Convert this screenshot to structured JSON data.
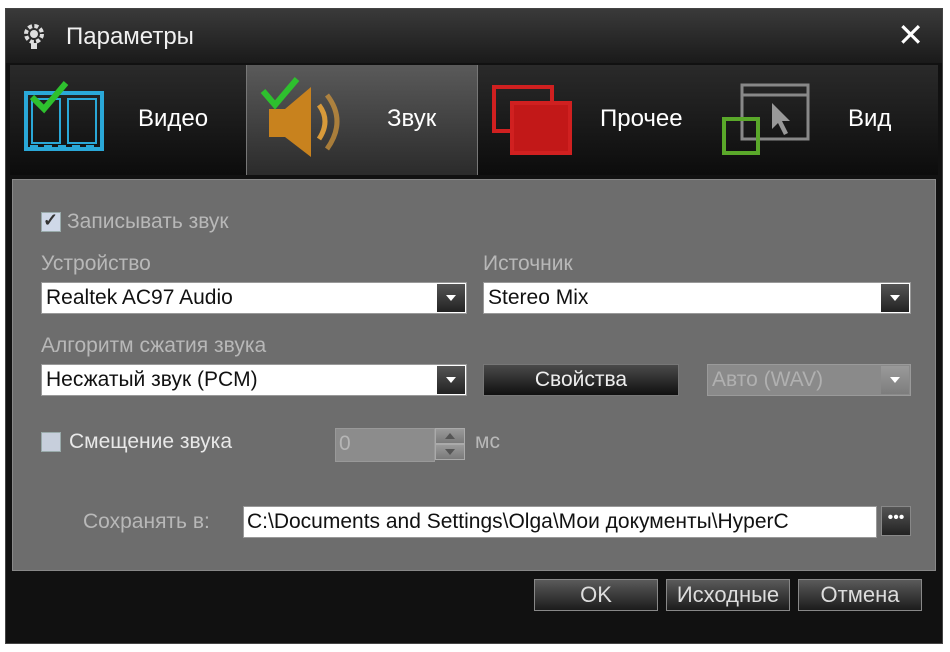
{
  "window": {
    "title": "Параметры",
    "icons": {
      "app": "gear-icon",
      "close": "close-icon"
    },
    "close_glyph": "✕"
  },
  "tabs": [
    {
      "label": "Видео",
      "icon": "video-film-icon",
      "active": false
    },
    {
      "label": "Звук",
      "icon": "speaker-icon",
      "active": true
    },
    {
      "label": "Прочее",
      "icon": "windows-icon",
      "active": false
    },
    {
      "label": "Вид",
      "icon": "cursor-window-icon",
      "active": false
    }
  ],
  "audio": {
    "record_sound": {
      "label": "Записывать звук",
      "checked": true
    },
    "device": {
      "label": "Устройство",
      "value": "Realtek AC97 Audio"
    },
    "source": {
      "label": "Источник",
      "value": "Stereo Mix"
    },
    "codec": {
      "label": "Алгоритм сжатия звука",
      "value": "Несжатый звук (PCM)"
    },
    "properties_button": "Свойства",
    "format": {
      "value": "Авто (WAV)",
      "enabled": false
    },
    "offset": {
      "label": "Смещение звука",
      "checked": false,
      "value": "0",
      "unit": "мс"
    },
    "save_to": {
      "label": "Сохранять в:",
      "value": "C:\\Documents and Settings\\Olga\\Мои документы\\HyperC",
      "browse": "•••"
    }
  },
  "footer": {
    "ok": "OK",
    "defaults": "Исходные",
    "cancel": "Отмена"
  },
  "colors": {
    "accent_green": "#2ec02e",
    "title_bg": "#2a2a2a",
    "panel_bg": "#6d6d6d"
  }
}
